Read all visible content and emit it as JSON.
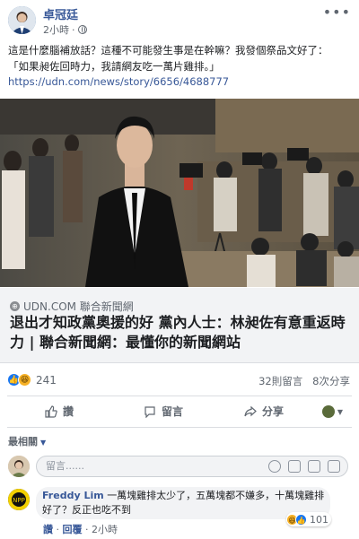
{
  "post": {
    "author": "卓冠廷",
    "time": "2小時",
    "more": "•••",
    "text_line1": "這是什麼腦補放話？這種不可能發生事是在幹嘛？我發個祭品文好了：",
    "text_line2": "「如果昶佐回時力，我請網友吃一萬片雞排。」",
    "link": "https://udn.com/news/story/6656/4688777"
  },
  "link_preview": {
    "source": "UDN.COM 聯合新聞網",
    "title": "退出才知政黨奧援的好 黨內人士：林昶佐有意重返時力 | 聯合新聞網：最懂你的新聞網站"
  },
  "stats": {
    "reaction_count": "241",
    "comments": "32則留言",
    "shares": "8次分享"
  },
  "actions": {
    "like": "讚",
    "comment": "留言",
    "share": "分享"
  },
  "comments_section": {
    "sort_label": "最相關",
    "input_placeholder": "留言......"
  },
  "top_comment": {
    "author": "Freddy Lim",
    "text": "一萬塊雞排太少了，五萬塊都不嫌多，十萬塊雞排好了？反正也吃不到",
    "reactions": "101",
    "like": "讚",
    "reply": "回覆",
    "time": "2小時"
  },
  "colors": {
    "link_blue": "#385898",
    "meta_gray": "#606770",
    "like_blue": "#1877f2",
    "haha_yellow": "#f7b125"
  }
}
